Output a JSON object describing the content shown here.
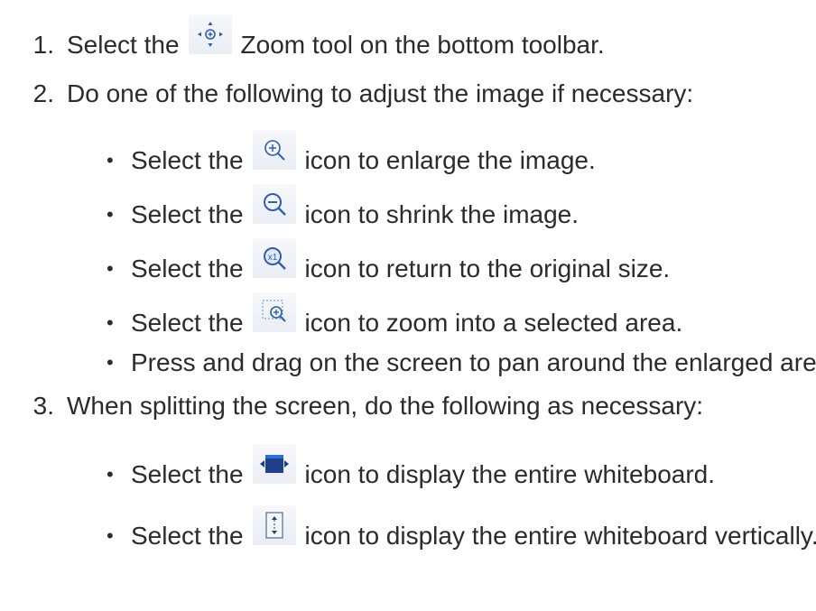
{
  "steps": [
    {
      "number": "1.",
      "before_icon": "Select the",
      "icon": "zoom-tool-icon",
      "after_icon": "Zoom tool on the bottom toolbar."
    },
    {
      "number": "2.",
      "text": "Do one of the following to adjust the image if necessary:",
      "bullets": [
        {
          "before_icon": "Select the",
          "icon": "zoom-in-icon",
          "after_icon": "icon to enlarge the image."
        },
        {
          "before_icon": "Select the",
          "icon": "zoom-out-icon",
          "after_icon": "icon to shrink the image."
        },
        {
          "before_icon": "Select the",
          "icon": "original-size-icon",
          "after_icon": "icon to return to the original size."
        },
        {
          "before_icon": "Select the",
          "icon": "zoom-area-icon",
          "after_icon": "icon to zoom into a selected area."
        },
        {
          "text": "Press and drag on the screen to pan around the enlarged area."
        }
      ]
    },
    {
      "number": "3.",
      "text": "When splitting the screen, do the following as necessary:",
      "bullets": [
        {
          "before_icon": "Select the",
          "icon": "fit-width-icon",
          "after_icon": "icon to display the entire whiteboard."
        },
        {
          "before_icon": "Select the",
          "icon": "fit-height-icon",
          "after_icon": "icon to display the entire whiteboard vertically."
        }
      ]
    }
  ],
  "bullet_char": "•",
  "colors": {
    "text": "#2b2b2b",
    "icon_blue": "#2f5fa8",
    "icon_dark_blue": "#1f3f8a",
    "icon_bg": "#eef2f7"
  }
}
